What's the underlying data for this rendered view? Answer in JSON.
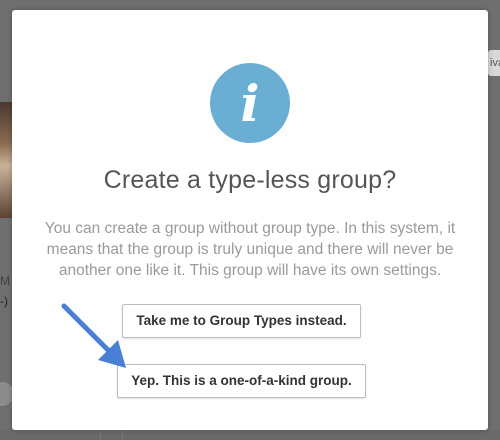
{
  "background": {
    "top_right_fragment": "iva",
    "left_text_1": "M",
    "left_text_2": "-)"
  },
  "modal": {
    "icon": "info-icon",
    "icon_glyph": "i",
    "icon_color": "#6aaed3",
    "title": "Create a type-less group?",
    "body": "You can create a group without group type. In this system, it means that the group is truly unique and there will never be another one like it. This group will have its own settings.",
    "secondary_button_label": "Take me to Group Types instead.",
    "primary_button_label": "Yep. This is a one-of-a-kind group."
  },
  "annotation": {
    "arrow_icon": "arrow-pointer-icon",
    "arrow_color": "#4a7fd6"
  }
}
